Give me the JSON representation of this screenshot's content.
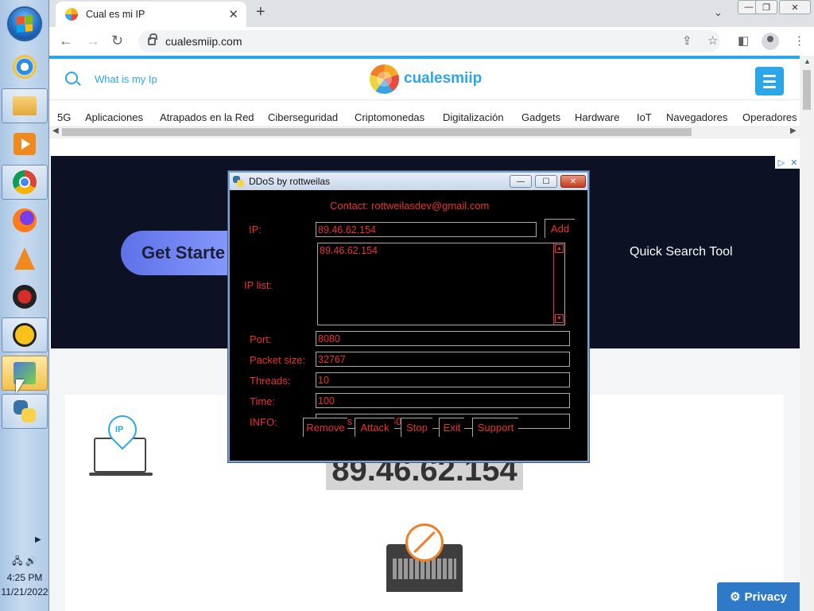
{
  "taskbar": {
    "clock_time": "4:25 PM",
    "clock_date": "11/21/2022"
  },
  "browser": {
    "tab_title": "Cual es mi IP",
    "url": "cualesmiip.com"
  },
  "site": {
    "search_label": "What is my Ip",
    "logo_text": "cualesmiip",
    "categories": [
      "5G",
      "Aplicaciones",
      "Atrapados en la Red",
      "Ciberseguridad",
      "Criptomonedas",
      "Digitalización",
      "Gadgets",
      "Hardware",
      "IoT",
      "Navegadores",
      "Operadores"
    ],
    "ad_cta": "Get Starte",
    "ad_tagline": "Quick Search Tool",
    "ip_display": "89.46.62.154",
    "ip_pin_label": "IP",
    "privacy_button": "Privacy"
  },
  "ddos": {
    "title": "DDoS by rottweilas",
    "contact": "Contact: rottweilasdev@gmail.com",
    "ip_label": "IP:",
    "ip_value": "89.46.62.154",
    "add_button": "Add",
    "ip_list_label": "IP list:",
    "ip_list": [
      "89.46.62.154"
    ],
    "port_label": "Port:",
    "port_value": "8080",
    "packet_size_label": "Packet size:",
    "packet_size_value": "32767",
    "threads_label": "Threads:",
    "threads_value": "10",
    "time_label": "Time:",
    "time_value": "100",
    "info_label": "INFO:",
    "info_value": "packets sent: 2440",
    "buttons": {
      "remove": "Remove",
      "attack": "Attack",
      "stop": "Stop",
      "exit": "Exit",
      "support": "Support"
    }
  }
}
